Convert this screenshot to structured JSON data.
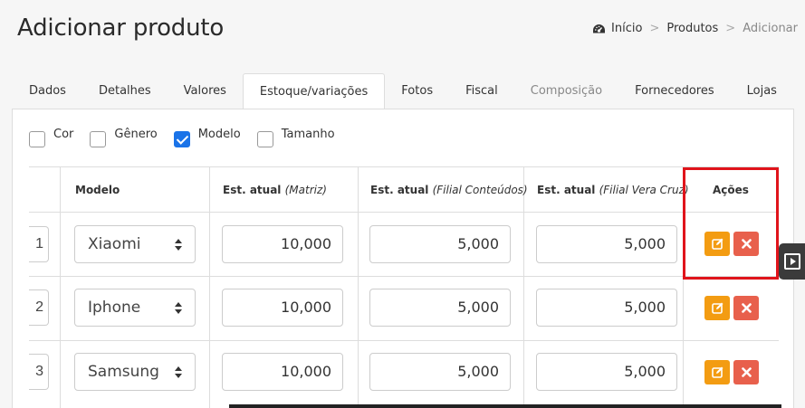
{
  "page": {
    "title": "Adicionar produto"
  },
  "breadcrumb": {
    "home": "Início",
    "products": "Produtos",
    "current": "Adicionar",
    "separator": ">"
  },
  "tabs": [
    {
      "label": "Dados",
      "state": "normal"
    },
    {
      "label": "Detalhes",
      "state": "normal"
    },
    {
      "label": "Valores",
      "state": "normal"
    },
    {
      "label": "Estoque/variações",
      "state": "active"
    },
    {
      "label": "Fotos",
      "state": "normal"
    },
    {
      "label": "Fiscal",
      "state": "normal"
    },
    {
      "label": "Composição",
      "state": "disabled"
    },
    {
      "label": "Fornecedores",
      "state": "normal"
    },
    {
      "label": "Lojas",
      "state": "normal"
    }
  ],
  "filters": [
    {
      "label": "Cor",
      "checked": false
    },
    {
      "label": "Gênero",
      "checked": false
    },
    {
      "label": "Modelo",
      "checked": true
    },
    {
      "label": "Tamanho",
      "checked": false
    }
  ],
  "table": {
    "headers": {
      "modelo": "Modelo",
      "est_matriz": "Est. atual",
      "est_matriz_sub": "(Matriz)",
      "est_conteudos": "Est. atual",
      "est_conteudos_sub": "(Filial Conteúdos)",
      "est_vera": "Est. atual",
      "est_vera_sub": "(Filial Vera Cruz)",
      "acoes": "Ações"
    },
    "rows": [
      {
        "index": "1",
        "modelo": "Xiaomi",
        "matriz": "10,000",
        "conteudos": "5,000",
        "vera": "5,000"
      },
      {
        "index": "2",
        "modelo": "Iphone",
        "matriz": "10,000",
        "conteudos": "5,000",
        "vera": "5,000"
      },
      {
        "index": "3",
        "modelo": "Samsung",
        "matriz": "10,000",
        "conteudos": "5,000",
        "vera": "5,000"
      }
    ]
  },
  "colors": {
    "edit_button": "#f39c12",
    "delete_button": "#e8604c",
    "checkbox_checked": "#1a73e8",
    "highlight": "#e0141b"
  }
}
